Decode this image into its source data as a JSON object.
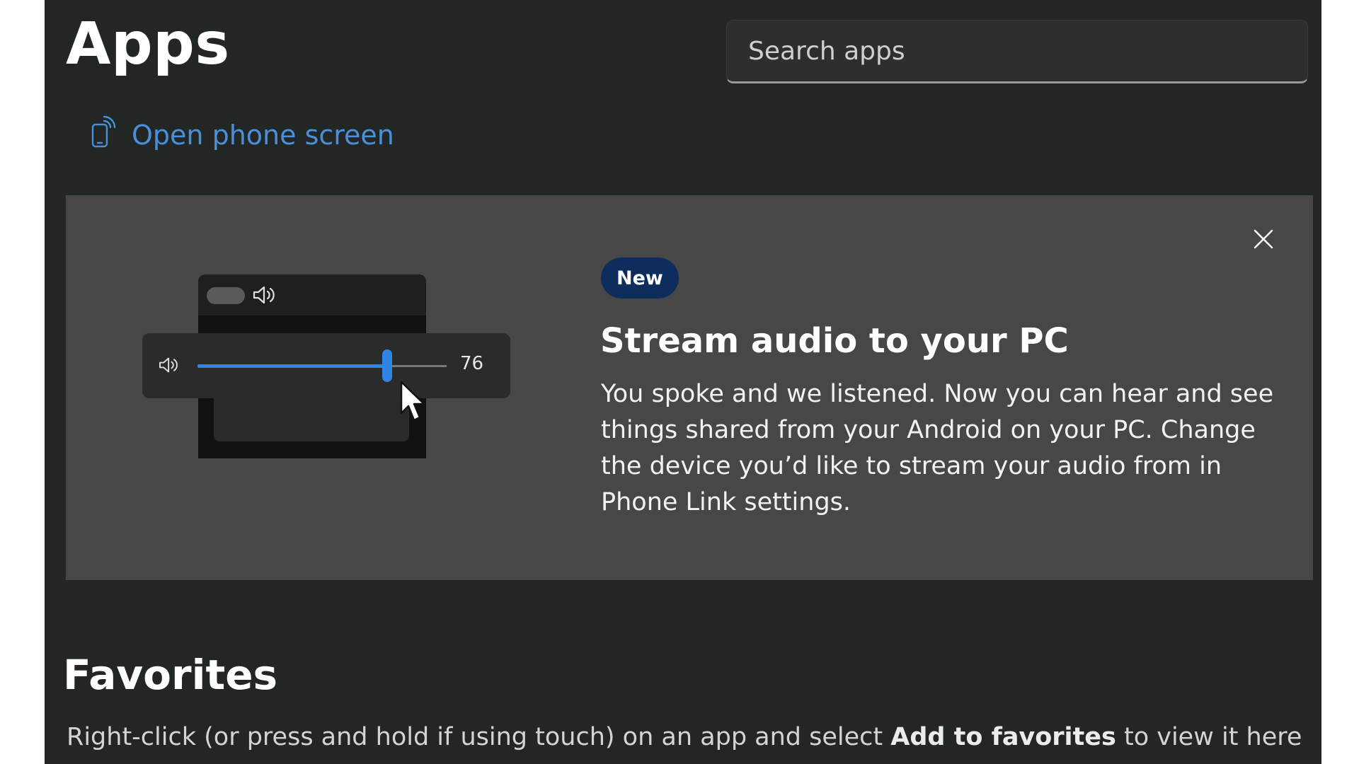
{
  "header": {
    "title": "Apps",
    "search_placeholder": "Search apps"
  },
  "phone_link": {
    "label": "Open phone screen",
    "icon": "phone-cast-icon"
  },
  "banner": {
    "badge": "New",
    "title": "Stream audio to your PC",
    "body": "You spoke and we listened. Now you can hear and see things shared from your Android on your PC. Change the device you’d like to stream your audio from in Phone Link settings.",
    "close_icon": "close-icon",
    "illustration": {
      "volume_value": "76",
      "volume_level": 0.76,
      "icons": [
        "speaker-icon",
        "cursor-icon"
      ]
    }
  },
  "favorites": {
    "title": "Favorites",
    "hint_prefix": "Right-click (or press and hold if using touch) on an app and select ",
    "hint_bold": "Add to favorites",
    "hint_suffix": " to view it here"
  },
  "colors": {
    "background": "#222624",
    "banner": "#474747",
    "accent_link": "#4a8fd8",
    "slider": "#2f86e6",
    "badge": "#0f2d5c"
  }
}
